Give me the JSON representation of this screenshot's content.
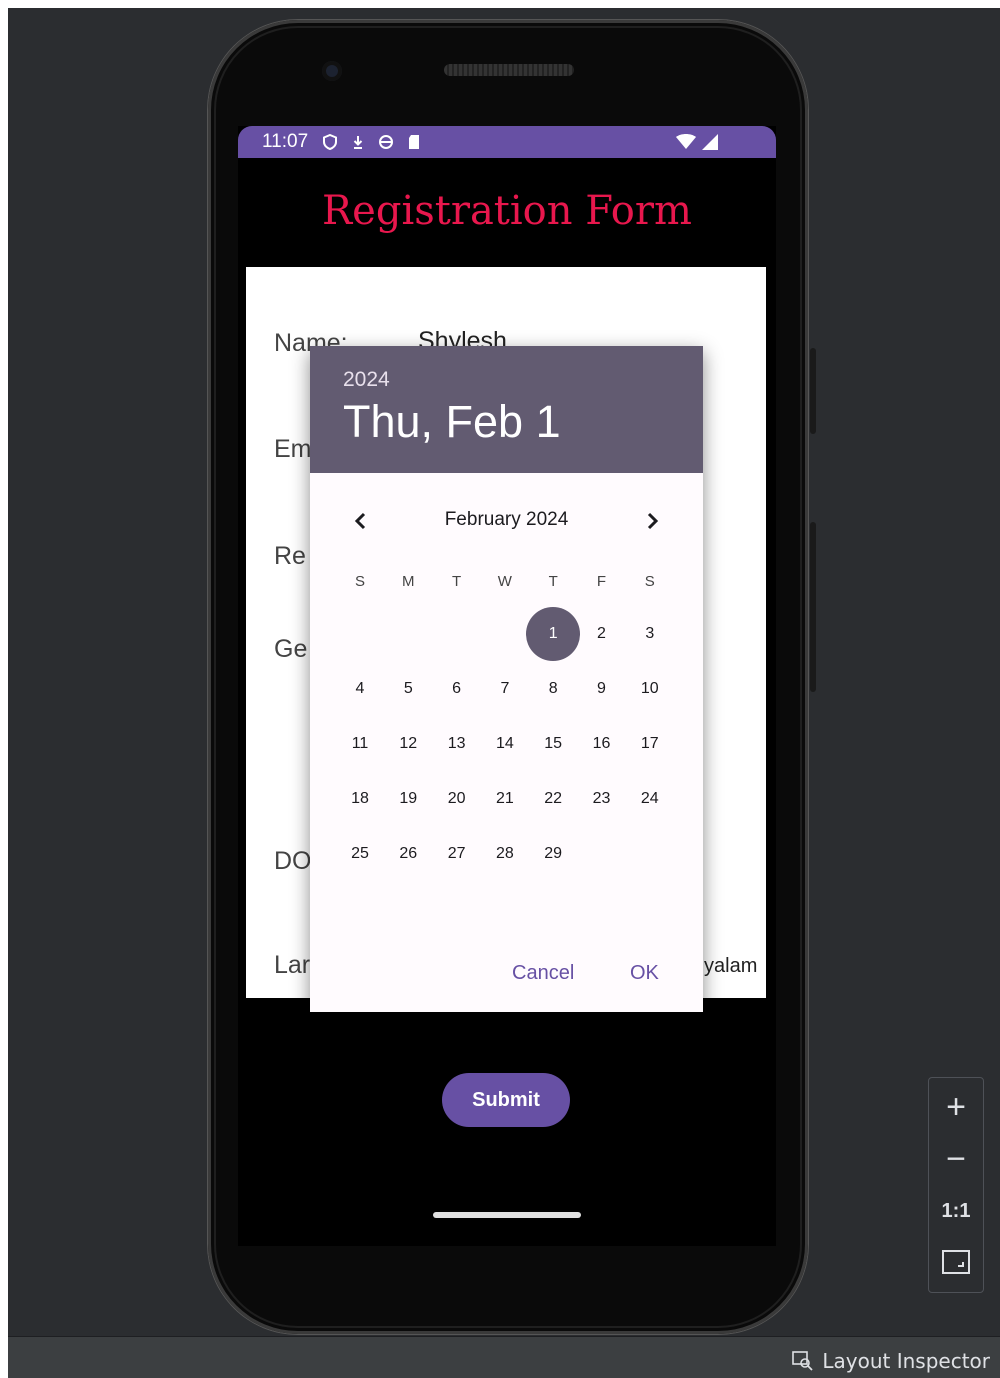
{
  "status_bar": {
    "time": "11:07",
    "icons": [
      "shield-icon",
      "download-icon",
      "sync-icon",
      "sd-card-icon"
    ],
    "right_icons": [
      "wifi-icon",
      "signal-icon"
    ],
    "color": "#6750a4"
  },
  "form": {
    "title": "Registration Form",
    "title_color": "#e8174d",
    "name_label": "Name:",
    "name_value": "Shylesh",
    "email_label": "Em",
    "reg_label": "Re",
    "gender_label": "Ge",
    "dob_label": "DO",
    "language_label": "Lar",
    "language_value": "yalam",
    "submit_label": "Submit"
  },
  "date_picker": {
    "year": "2024",
    "selected_date": "Thu, Feb 1",
    "month_label": "February 2024",
    "weekdays": [
      "S",
      "M",
      "T",
      "W",
      "T",
      "F",
      "S"
    ],
    "first_weekday_index": 4,
    "days": [
      "1",
      "2",
      "3",
      "4",
      "5",
      "6",
      "7",
      "8",
      "9",
      "10",
      "11",
      "12",
      "13",
      "14",
      "15",
      "16",
      "17",
      "18",
      "19",
      "20",
      "21",
      "22",
      "23",
      "24",
      "25",
      "26",
      "27",
      "28",
      "29"
    ],
    "selected_day": "1",
    "cancel_label": "Cancel",
    "ok_label": "OK",
    "header_color": "#625b71"
  },
  "zoom_controls": {
    "zoom_in": "+",
    "zoom_out": "−",
    "actual_size": "1:1"
  },
  "bottom_bar": {
    "layout_inspector_label": "Layout Inspector"
  }
}
